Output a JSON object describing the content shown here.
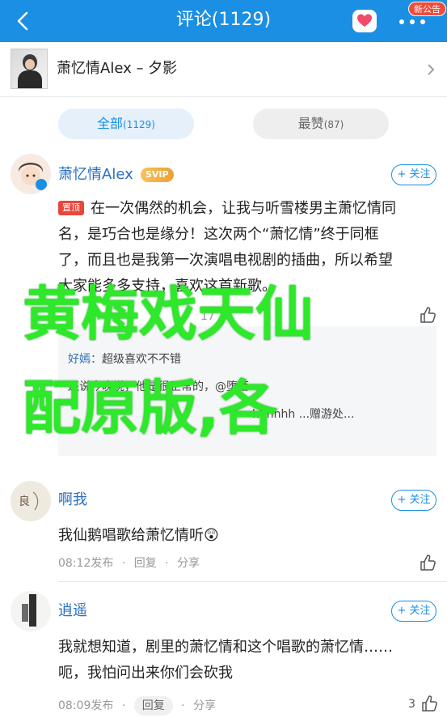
{
  "topbar": {
    "title": "评论(1129)",
    "notice_badge": "新公告"
  },
  "song": {
    "title": "萧忆情Alex – 夕影"
  },
  "tabs": {
    "all_label": "全部",
    "all_count": "(1129)",
    "hot_label": "最赞",
    "hot_count": "(87)"
  },
  "comments": [
    {
      "user": "萧忆情Alex",
      "badge": "SVIP",
      "follow": "+ 关注",
      "pinned": "置顶",
      "lines": [
        "在一次偶然的机会，让我与听雪楼男主萧忆情同",
        "名，是巧合也是缘分！这次两个“萧忆情”终于同框",
        "了，而且也是我第一次演唱电视剧的插曲，所以希望",
        "大家能多多支持，喜欢这首新歌。"
      ],
      "meta_fragment": "17",
      "replies": [
        {
          "name": "好嫣：",
          "text": "超级喜欢不不错"
        },
        {
          "name": "",
          "text": "还说今晚说，他是很正常的，@堕落"
        },
        {
          "name": "",
          "text": "hhhhhh ...赠游处..."
        }
      ]
    },
    {
      "user": "啊我",
      "follow": "+ 关注",
      "text": "我仙鹅唱歌给萧忆情听😲",
      "time": "08:12发布",
      "reply": "回复",
      "share": "分享"
    },
    {
      "user": "逍遥",
      "follow": "+ 关注",
      "lines": [
        "我就想知道，剧里的萧忆情和这个唱歌的萧忆情……",
        "呃，我怕问出来你们会砍我"
      ],
      "time": "08:09发布",
      "reply": "回复",
      "share": "分享",
      "likes": "3"
    }
  ],
  "overlay": {
    "line1": "黄梅戏天仙",
    "line2": "配原版,各"
  },
  "colors": {
    "primary": "#1a8fe3",
    "overlay_green": "#2ee82a",
    "pin_red": "#e8473b"
  }
}
